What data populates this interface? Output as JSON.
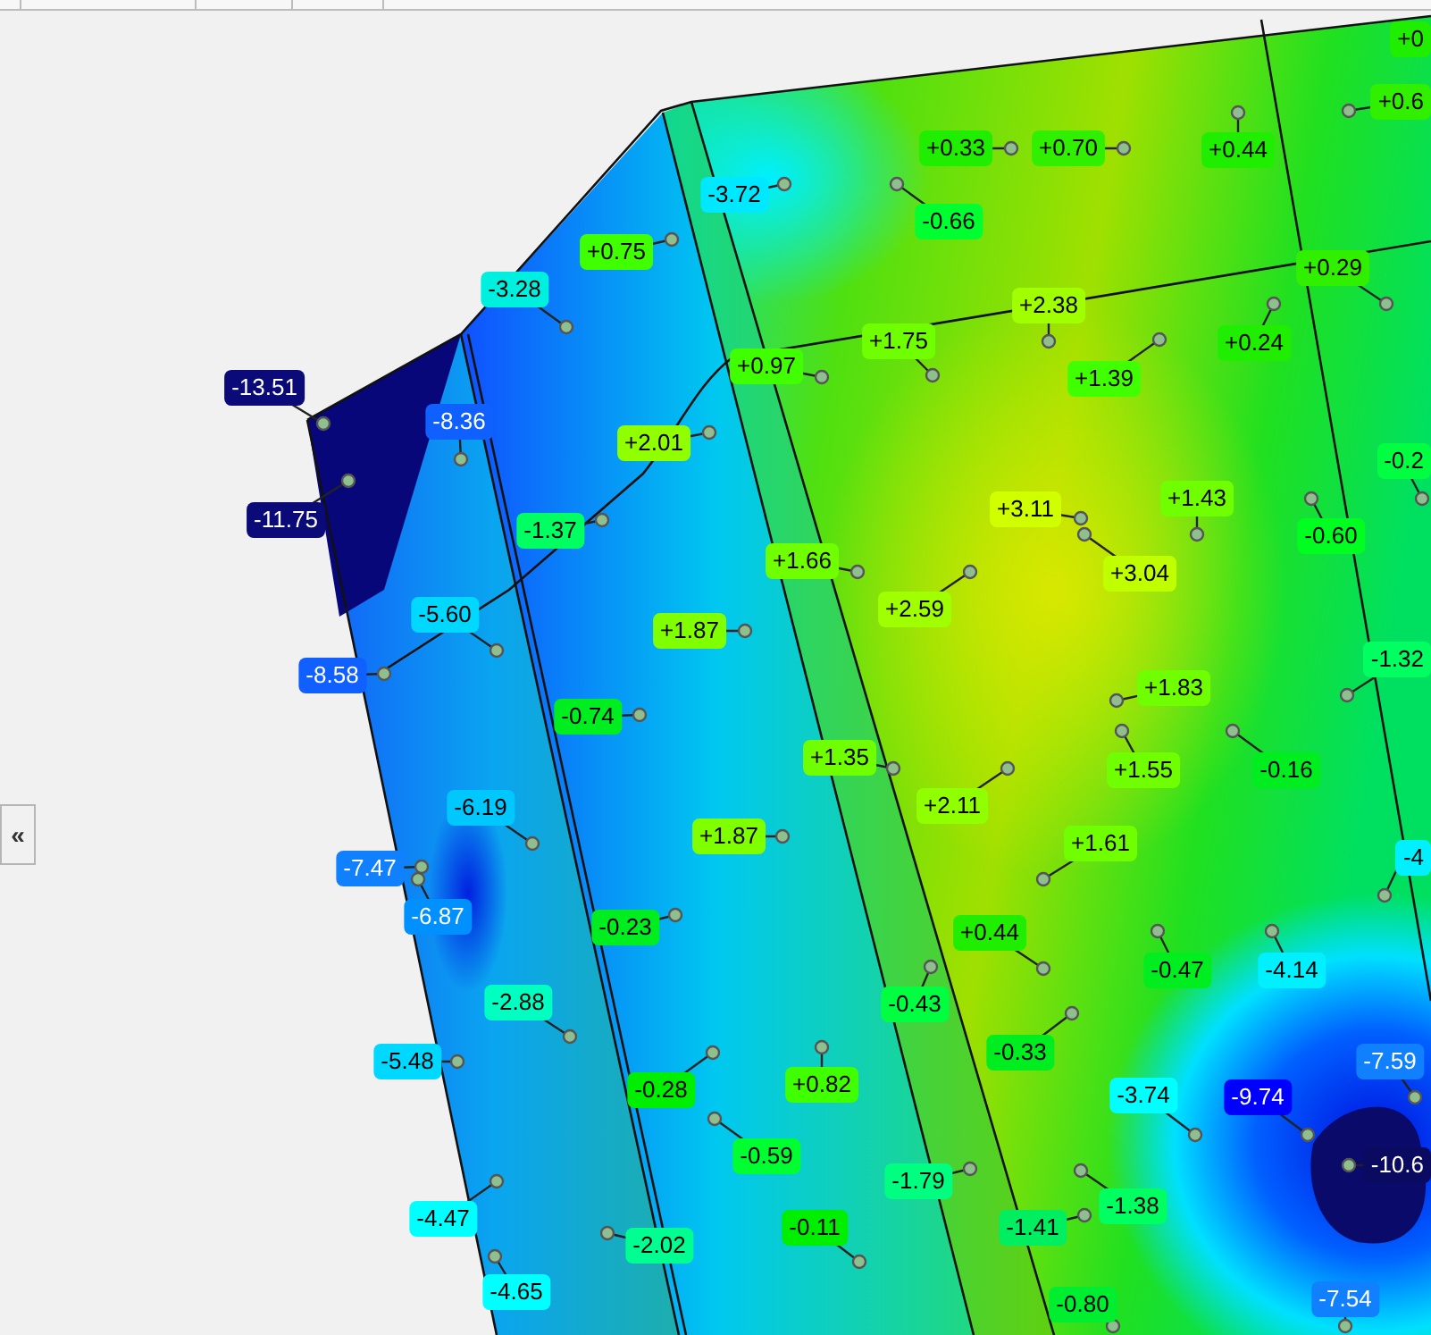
{
  "collapse_button": {
    "label": "«"
  },
  "labels": [
    {
      "text": "-13.51",
      "color": "#0a0a78"
    },
    {
      "text": "-8.36",
      "color": "#1060ff"
    },
    {
      "text": "-11.75",
      "color": "#0a0a78"
    },
    {
      "text": "-3.28",
      "color": "#00f0e0"
    },
    {
      "text": "+0.75",
      "color": "#40ff00"
    },
    {
      "text": "-3.72",
      "color": "#00e8ff"
    },
    {
      "text": "+2.01",
      "color": "#90ff00"
    },
    {
      "text": "-1.37",
      "color": "#00ff60"
    },
    {
      "text": "+0.97",
      "color": "#40ff00"
    },
    {
      "text": "-5.60",
      "color": "#00d8ff"
    },
    {
      "text": "-8.58",
      "color": "#1060ff"
    },
    {
      "text": "+1.87",
      "color": "#80ff00"
    },
    {
      "text": "+0.33",
      "color": "#20ee00"
    },
    {
      "text": "+0.70",
      "color": "#30f000"
    },
    {
      "text": "-0.66",
      "color": "#00ff30"
    },
    {
      "text": "+0.44",
      "color": "#20ee00"
    },
    {
      "text": "+0",
      "color": "#20ee00"
    },
    {
      "text": "+0.6",
      "color": "#30f000"
    },
    {
      "text": "+0.29",
      "color": "#30f000"
    },
    {
      "text": "+2.38",
      "color": "#a0ff00"
    },
    {
      "text": "+1.75",
      "color": "#70ff00"
    },
    {
      "text": "+1.39",
      "color": "#40ff00"
    },
    {
      "text": "+0.24",
      "color": "#20ee00"
    },
    {
      "text": "+3.11",
      "color": "#d0ff00"
    },
    {
      "text": "+3.04",
      "color": "#c0ff00"
    },
    {
      "text": "+1.43",
      "color": "#70ff00"
    },
    {
      "text": "-0.60",
      "color": "#00ff20"
    },
    {
      "text": "-0.2",
      "color": "#00ff40"
    },
    {
      "text": "+1.66",
      "color": "#70ff00"
    },
    {
      "text": "+2.59",
      "color": "#a0ff00"
    },
    {
      "text": "-1.32",
      "color": "#00ff60"
    },
    {
      "text": "-0.74",
      "color": "#00ee20"
    },
    {
      "text": "+1.35",
      "color": "#70ff00"
    },
    {
      "text": "+1.83",
      "color": "#70ff00"
    },
    {
      "text": "+1.55",
      "color": "#70ff00"
    },
    {
      "text": "-0.16",
      "color": "#00ee20"
    },
    {
      "text": "+2.11",
      "color": "#90ff00"
    },
    {
      "text": "+1.61",
      "color": "#70ff00"
    },
    {
      "text": "-6.19",
      "color": "#00c8ff"
    },
    {
      "text": "-7.47",
      "color": "#1080ff"
    },
    {
      "text": "-6.87",
      "color": "#0090ff"
    },
    {
      "text": "+1.87",
      "color": "#80ff00"
    },
    {
      "text": "-0.23",
      "color": "#00ee20"
    },
    {
      "text": "+0.44",
      "color": "#20ee00"
    },
    {
      "text": "-0.47",
      "color": "#00ee20"
    },
    {
      "text": "-4.14",
      "color": "#00f0ff"
    },
    {
      "text": "-4",
      "color": "#00f0ff"
    },
    {
      "text": "-0.43",
      "color": "#00ff40"
    },
    {
      "text": "-2.88",
      "color": "#00ffc0"
    },
    {
      "text": "-5.48",
      "color": "#00d8ff"
    },
    {
      "text": "-0.33",
      "color": "#00ee20"
    },
    {
      "text": "-0.28",
      "color": "#00ee00"
    },
    {
      "text": "+0.82",
      "color": "#40ff00"
    },
    {
      "text": "-3.74",
      "color": "#00ffff"
    },
    {
      "text": "-9.74",
      "color": "#0000ff"
    },
    {
      "text": "-7.59",
      "color": "#1080ff"
    },
    {
      "text": "-0.59",
      "color": "#00ff30"
    },
    {
      "text": "-10.6",
      "color": "#0a0a60"
    },
    {
      "text": "-1.79",
      "color": "#00ff80"
    },
    {
      "text": "-1.38",
      "color": "#00ff60"
    },
    {
      "text": "-1.41",
      "color": "#00ee60"
    },
    {
      "text": "-4.47",
      "color": "#00ffff"
    },
    {
      "text": "-2.02",
      "color": "#00ff90"
    },
    {
      "text": "-0.11",
      "color": "#00ee00"
    },
    {
      "text": "-4.65",
      "color": "#00ffff"
    },
    {
      "text": "-0.80",
      "color": "#00ee30"
    },
    {
      "text": "-7.54",
      "color": "#1080ff"
    }
  ]
}
